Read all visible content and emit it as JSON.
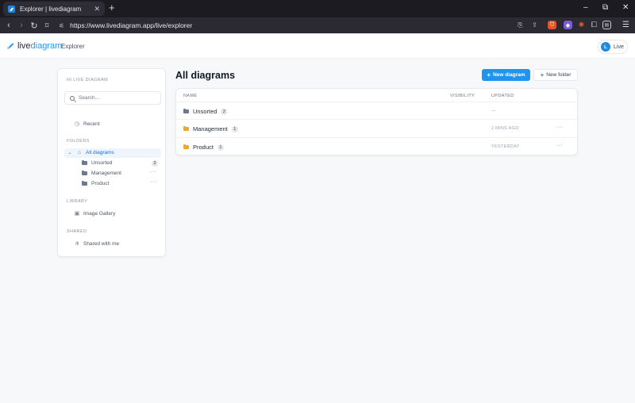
{
  "browser": {
    "tab_title": "Explorer | livediagram",
    "url": "https://www.livediagram.app/live/explorer",
    "ext_badge": "1"
  },
  "header": {
    "logo_prefix": "live",
    "logo_suffix": "diagram",
    "section": "Explorer",
    "live_avatar_letter": "L",
    "live_label": "Live"
  },
  "sidebar": {
    "greeting": "HI LIVE DIAGRAM",
    "search_placeholder": "Search...",
    "recent_label": "Recent",
    "folders_heading": "FOLDERS",
    "all_diagrams_label": "All diagrams",
    "folders": [
      {
        "name": "Unsorted",
        "count": "2",
        "color": "#6b7a90"
      },
      {
        "name": "Management",
        "more": "···",
        "color": "#6b7a90"
      },
      {
        "name": "Product",
        "more": "···",
        "color": "#6b7a90"
      }
    ],
    "library_heading": "LIBRARY",
    "image_gallery_label": "Image Gallery",
    "shared_heading": "SHARED",
    "shared_with_me_label": "Shared with me"
  },
  "main": {
    "title": "All diagrams",
    "new_diagram_label": "New diagram",
    "new_folder_label": "New folder",
    "columns": {
      "name": "NAME",
      "visibility": "VISIBILITY",
      "updated": "UPDATED"
    },
    "rows": [
      {
        "name": "Unsorted",
        "count": "2",
        "updated": "—",
        "more": "",
        "folder_color": "#6b7a90"
      },
      {
        "name": "Management",
        "count": "1",
        "updated": "2 MINS AGO",
        "more": "···",
        "folder_color": "#f5a524"
      },
      {
        "name": "Product",
        "count": "1",
        "updated": "YESTERDAY",
        "more": "···",
        "folder_color": "#f5a524"
      }
    ]
  },
  "colors": {
    "accent": "#1e95f0",
    "folder_orange": "#f5a524",
    "folder_gray": "#6b7a90"
  }
}
